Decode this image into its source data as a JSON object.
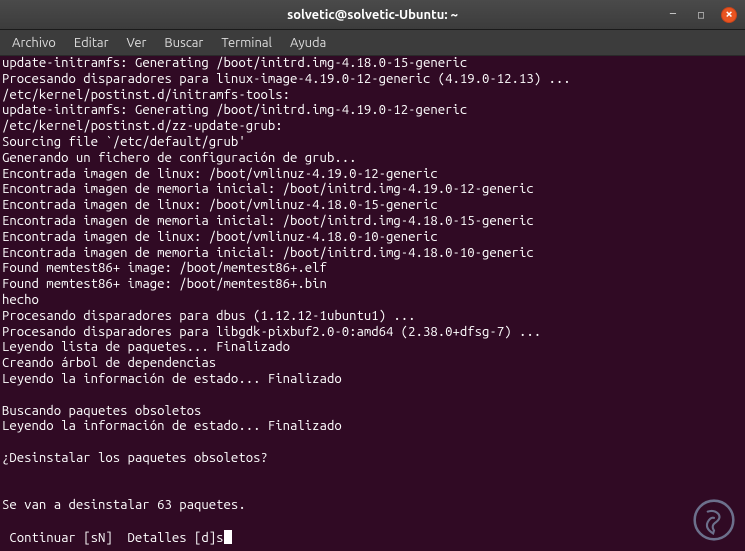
{
  "titlebar": {
    "title": "solvetic@solvetic-Ubuntu: ~"
  },
  "menubar": {
    "items": [
      {
        "label": "Archivo"
      },
      {
        "label": "Editar"
      },
      {
        "label": "Ver"
      },
      {
        "label": "Buscar"
      },
      {
        "label": "Terminal"
      },
      {
        "label": "Ayuda"
      }
    ]
  },
  "terminal": {
    "lines": [
      "update-initramfs: Generating /boot/initrd.img-4.18.0-15-generic",
      "Procesando disparadores para linux-image-4.19.0-12-generic (4.19.0-12.13) ...",
      "/etc/kernel/postinst.d/initramfs-tools:",
      "update-initramfs: Generating /boot/initrd.img-4.19.0-12-generic",
      "/etc/kernel/postinst.d/zz-update-grub:",
      "Sourcing file `/etc/default/grub'",
      "Generando un fichero de configuración de grub...",
      "Encontrada imagen de linux: /boot/vmlinuz-4.19.0-12-generic",
      "Encontrada imagen de memoria inicial: /boot/initrd.img-4.19.0-12-generic",
      "Encontrada imagen de linux: /boot/vmlinuz-4.18.0-15-generic",
      "Encontrada imagen de memoria inicial: /boot/initrd.img-4.18.0-15-generic",
      "Encontrada imagen de linux: /boot/vmlinuz-4.18.0-10-generic",
      "Encontrada imagen de memoria inicial: /boot/initrd.img-4.18.0-10-generic",
      "Found memtest86+ image: /boot/memtest86+.elf",
      "Found memtest86+ image: /boot/memtest86+.bin",
      "hecho",
      "Procesando disparadores para dbus (1.12.12-1ubuntu1) ...",
      "Procesando disparadores para libgdk-pixbuf2.0-0:amd64 (2.38.0+dfsg-7) ...",
      "Leyendo lista de paquetes... Finalizado",
      "Creando árbol de dependencias",
      "Leyendo la información de estado... Finalizado",
      "",
      "Buscando paquetes obsoletos",
      "Leyendo la información de estado... Finalizado",
      "",
      "¿Desinstalar los paquetes obsoletos?",
      "",
      "",
      "Se van a desinstalar 63 paquetes.",
      ""
    ],
    "prompt_line_prefix": " Continuar [sN]  Detalles [d]",
    "prompt_input": "s"
  }
}
